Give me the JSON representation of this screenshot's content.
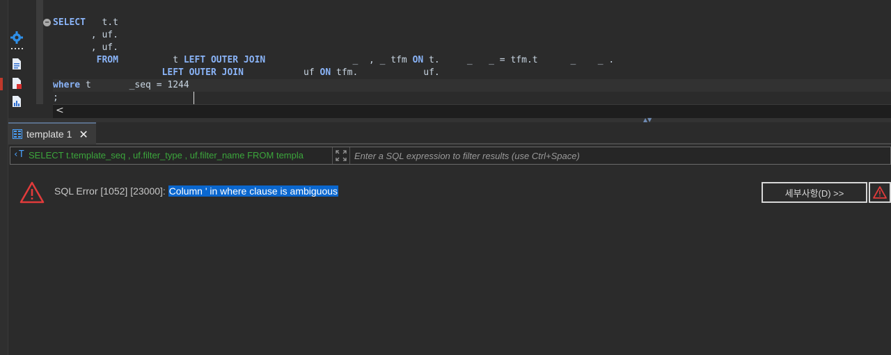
{
  "editor": {
    "lines": [
      [
        {
          "t": "SELECT",
          "c": "kw"
        },
        {
          "t": "   t.t",
          "c": "ident"
        }
      ],
      [
        {
          "t": "       , uf.",
          "c": "ident"
        }
      ],
      [
        {
          "t": "       , uf.",
          "c": "ident"
        }
      ],
      [
        {
          "t": "        FROM",
          "c": "kw"
        },
        {
          "t": "          t ",
          "c": "ident"
        },
        {
          "t": "LEFT OUTER JOIN",
          "c": "kw"
        },
        {
          "t": "                _  , _ tfm ",
          "c": "ident"
        },
        {
          "t": "ON",
          "c": "kw"
        },
        {
          "t": " t.     _   _ = tfm.t      _    _ .",
          "c": "ident"
        }
      ],
      [
        {
          "t": "                    ",
          "c": "ident"
        },
        {
          "t": "LEFT OUTER JOIN",
          "c": "kw"
        },
        {
          "t": "           uf ",
          "c": "ident"
        },
        {
          "t": "ON",
          "c": "kw"
        },
        {
          "t": " tfm.            uf.",
          "c": "ident"
        }
      ],
      [
        {
          "t": "where",
          "c": "kw"
        },
        {
          "t": " t       _seq = 1244",
          "c": "ident"
        }
      ],
      [
        {
          "t": ";",
          "c": "ident"
        }
      ]
    ],
    "scroll_left_glyph": "<"
  },
  "results": {
    "tab_label": "template 1",
    "sql_preview": "SELECT t.template_seq , uf.filter_type , uf.filter_name FROM templa",
    "filter_placeholder": "Enter a SQL expression to filter results (use Ctrl+Space)",
    "error_prefix": "SQL Error [1052] [23000]: ",
    "error_highlight": "Column                  ' in where clause is ambiguous",
    "details_button": "세부사항(D) >>"
  },
  "icons": {
    "fold": "minus-circle",
    "tool_1": "gear-icon",
    "tool_2": "document-icon",
    "tool_3": "document-error-icon",
    "tool_4": "document-chart-icon",
    "tab": "grid-icon",
    "sql_text": "sql-text-icon",
    "expand": "expand-icon",
    "error": "warning-triangle-icon",
    "alert": "warning-triangle-icon"
  },
  "colors": {
    "background": "#2b2b2b",
    "keyword": "#8ab4f8",
    "error_red": "#e23b3b",
    "selection": "#0a67cf",
    "sql_green": "#3ca63c"
  }
}
